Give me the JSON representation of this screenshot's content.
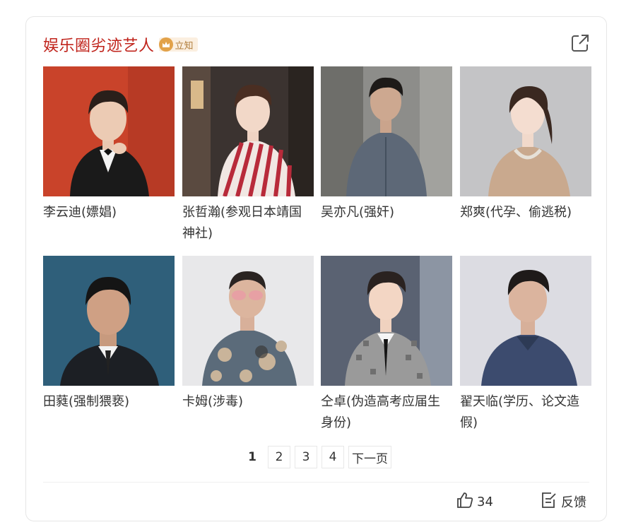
{
  "header": {
    "title": "娱乐圈劣迹艺人",
    "badge_label": "立知"
  },
  "artists": [
    {
      "label": "李云迪(嫖娼)"
    },
    {
      "label": "张哲瀚(参观日本靖国神社)"
    },
    {
      "label": "吴亦凡(强奸)"
    },
    {
      "label": "郑爽(代孕、偷逃税)"
    },
    {
      "label": "田蕤(强制猥亵)"
    },
    {
      "label": "卡姆(涉毒)"
    },
    {
      "label": "仝卓(伪造高考应届生身份)"
    },
    {
      "label": "翟天临(学历、论文造假)"
    }
  ],
  "pagination": {
    "pages": [
      "1",
      "2",
      "3",
      "4"
    ],
    "current": "1",
    "next_label": "下一页"
  },
  "footer": {
    "like_count": "34",
    "feedback_label": "反馈"
  },
  "colors": {
    "title": "#c0241c",
    "badge_bg": "#fbefe0",
    "badge_icon": "#e2a24a"
  }
}
